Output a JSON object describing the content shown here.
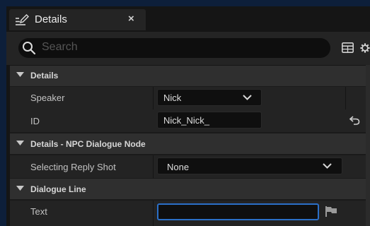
{
  "tab": {
    "title": "Details",
    "close": "×",
    "icon": "edit-pencil-icon"
  },
  "search": {
    "placeholder": "Search",
    "icon": "search-icon"
  },
  "toolbar": {
    "table_icon": "table-view-icon",
    "settings_icon": "gear-icon"
  },
  "sections": [
    {
      "label": "Details"
    },
    {
      "label": "Details - NPC Dialogue Node"
    },
    {
      "label": "Dialogue Line"
    }
  ],
  "fields": {
    "speaker": {
      "label": "Speaker",
      "value": "Nick"
    },
    "id": {
      "label": "ID",
      "value": "Nick_Nick_"
    },
    "selecting_reply_shot": {
      "label": "Selecting Reply Shot",
      "value": "None"
    },
    "text": {
      "label": "Text",
      "value": ""
    }
  },
  "colors": {
    "accent": "#2b6fc7",
    "background": "#0d1f3a"
  }
}
